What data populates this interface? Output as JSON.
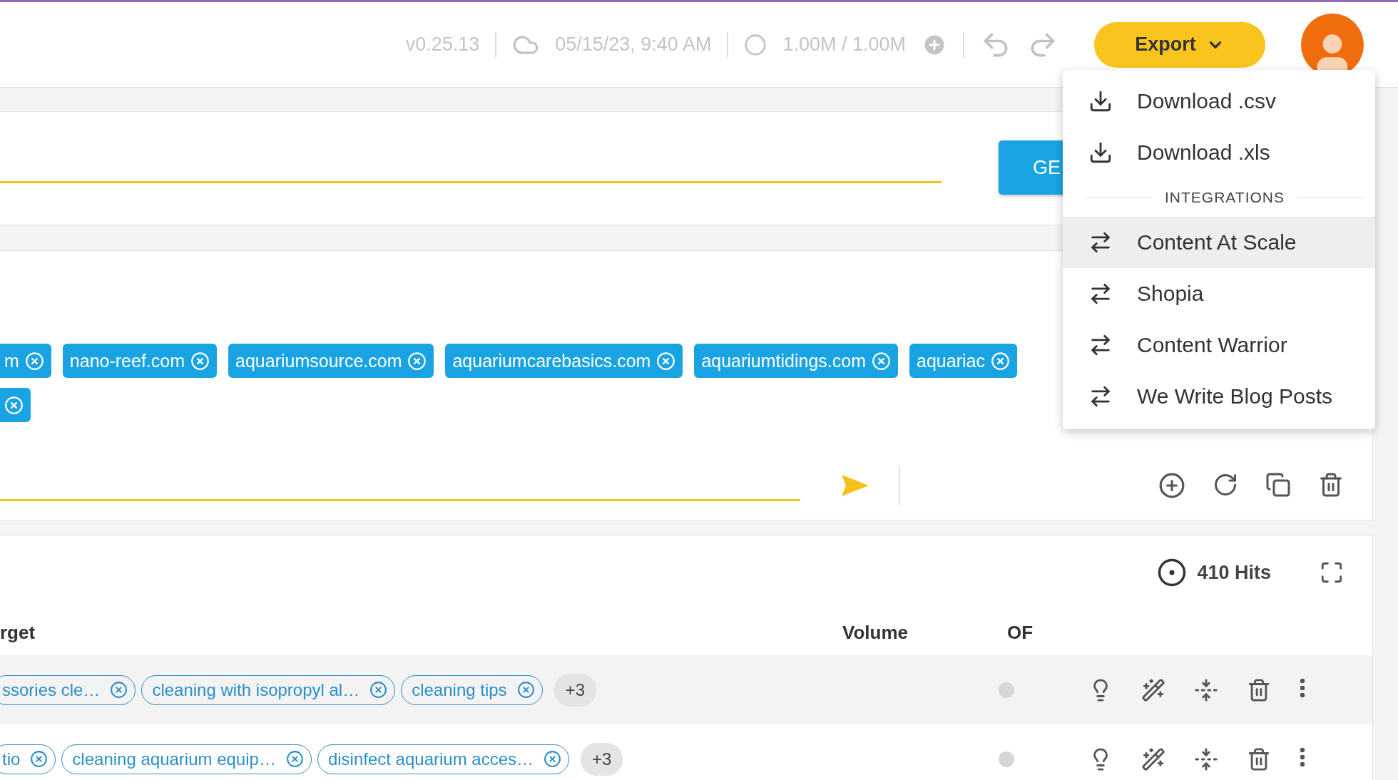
{
  "header": {
    "version": "v0.25.13",
    "saved": "05/15/23, 9:40 AM",
    "credits": "1.00M / 1.00M",
    "export_label": "Export"
  },
  "export_menu": {
    "items": [
      {
        "kind": "download",
        "label": "Download .csv",
        "selected": false
      },
      {
        "kind": "download",
        "label": "Download .xls",
        "selected": false
      },
      {
        "kind": "section",
        "label": "INTEGRATIONS"
      },
      {
        "kind": "integration",
        "label": "Content At Scale",
        "selected": true
      },
      {
        "kind": "integration",
        "label": "Shopia",
        "selected": false
      },
      {
        "kind": "integration",
        "label": "Content Warrior",
        "selected": false
      },
      {
        "kind": "integration",
        "label": "We Write Blog Posts",
        "selected": false
      }
    ]
  },
  "generate_card": {
    "button": "GE"
  },
  "domains_card": {
    "chips": [
      {
        "kind": "text",
        "label": "m"
      },
      {
        "kind": "text",
        "label": "nano-reef.com"
      },
      {
        "kind": "text",
        "label": "aquariumsource.com"
      },
      {
        "kind": "text",
        "label": "aquariumcarebasics.com"
      },
      {
        "kind": "text",
        "label": "aquariumtidings.com"
      },
      {
        "kind": "text",
        "label": "aquariac"
      },
      {
        "kind": "icon_only"
      }
    ]
  },
  "results": {
    "hits": "410 Hits",
    "columns": [
      "rget",
      "Volume",
      "OF"
    ],
    "rows": [
      {
        "highlighted": true,
        "keywords": [
          "ssories cle…",
          "cleaning with isopropyl al…",
          "cleaning tips"
        ],
        "more": "+3"
      },
      {
        "highlighted": false,
        "keywords": [
          "tio",
          "cleaning aquarium equip…",
          "disinfect aquarium acces…"
        ],
        "more": "+3"
      }
    ]
  }
}
